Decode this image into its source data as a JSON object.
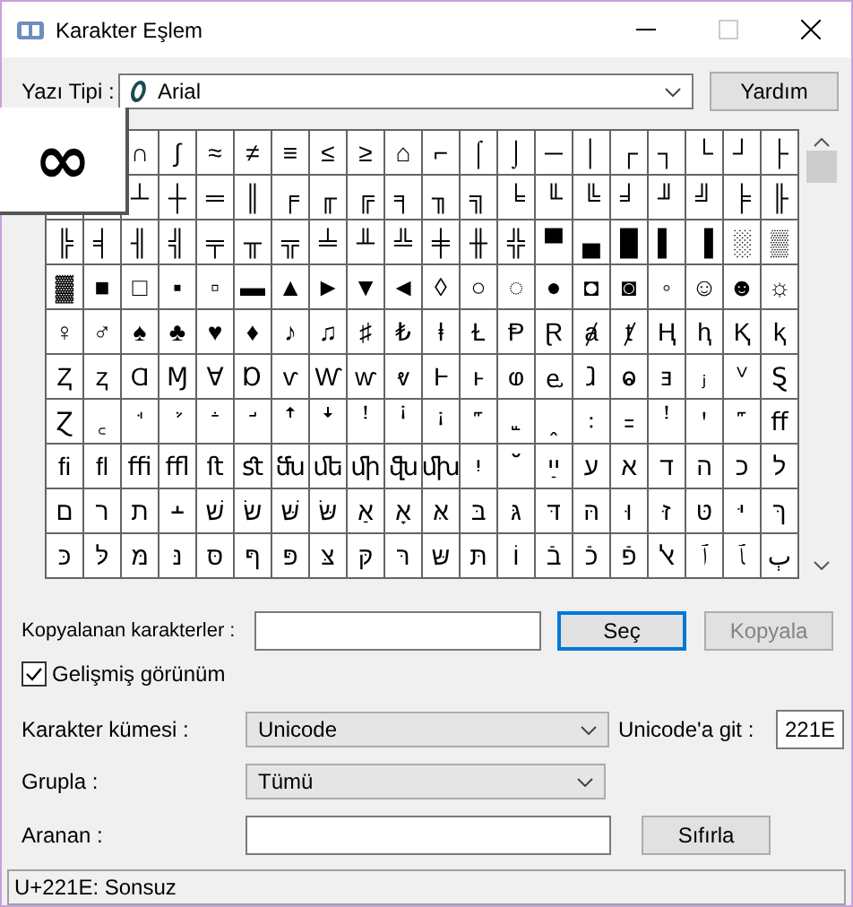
{
  "window": {
    "title": "Karakter Eşlem"
  },
  "font": {
    "label": "Yazı Tipi :",
    "value": "Arial"
  },
  "help_button": "Yardım",
  "magnified": "∞",
  "grid": {
    "rows": [
      [
        "",
        "",
        "∩",
        "∫",
        "≈",
        "≠",
        "≡",
        "≤",
        "≥",
        "⌂",
        "⌐",
        "⌠",
        "⌡",
        "─",
        "│",
        "┌",
        "┐",
        "└",
        "┘",
        "├"
      ],
      [
        "",
        "",
        "┴",
        "┼",
        "═",
        "║",
        "╒",
        "╓",
        "╔",
        "╕",
        "╖",
        "╗",
        "╘",
        "╙",
        "╚",
        "╛",
        "╜",
        "╝",
        "╞",
        "╟"
      ],
      [
        "╠",
        "╡",
        "╢",
        "╣",
        "╤",
        "╥",
        "╦",
        "╧",
        "╨",
        "╩",
        "╪",
        "╫",
        "╬",
        "▀",
        "▄",
        "█",
        "▌",
        "▐",
        "░",
        "▒"
      ],
      [
        "▓",
        "■",
        "□",
        "▪",
        "▫",
        "▬",
        "▲",
        "►",
        "▼",
        "◄",
        "◊",
        "○",
        "◌",
        "●",
        "◘",
        "◙",
        "◦",
        "☺",
        "☻",
        "☼"
      ],
      [
        "♀",
        "♂",
        "♠",
        "♣",
        "♥",
        "♦",
        "♪",
        "♫",
        "♯",
        "₺",
        "ⱡ",
        "Ɫ",
        "Ᵽ",
        "Ɽ",
        "ⱥ",
        "ⱦ",
        "Ⱨ",
        "ⱨ",
        "Ⱪ",
        "ⱪ"
      ],
      [
        "Ⱬ",
        "ⱬ",
        "Ɑ",
        "Ɱ",
        "Ɐ",
        "Ɒ",
        "ⱱ",
        "Ⱳ",
        "ⱳ",
        "ⱴ",
        "Ⱶ",
        "ⱶ",
        "ⱷ",
        "ⱸ",
        "ⱹ",
        "ⱺ",
        "ⱻ",
        "ⱼ",
        "ⱽ",
        "Ȿ"
      ],
      [
        "Ɀ",
        "꜀",
        "ꜗ",
        "ꜘ",
        "ꜙ",
        "ꜚ",
        "ꜛ",
        "ꜜ",
        "ꜝ",
        "ꜞ",
        "ꜟ",
        "꜠",
        "꜡",
        "ꞈ",
        "꞉",
        "꞊",
        "ꜝ",
        "ꞌ",
        "꜠",
        "ﬀ"
      ],
      [
        "ﬁ",
        "ﬂ",
        "ﬃ",
        "ﬄ",
        "ﬅ",
        "ﬆ",
        "ﬓ",
        "ﬔ",
        "ﬕ",
        "ﬖ",
        "ﬗ",
        "יִ",
        "ﬞ",
        "ײַ",
        "ﬠ",
        "ﬡ",
        "ﬢ",
        "ﬣ",
        "ﬤ",
        "ﬥ"
      ],
      [
        "ﬦ",
        "ﬧ",
        "ﬨ",
        "﬩",
        "שׁ",
        "שׂ",
        "שּׁ",
        "שּׂ",
        "אַ",
        "אָ",
        "אּ",
        "בּ",
        "גּ",
        "דּ",
        "הּ",
        "וּ",
        "זּ",
        "טּ",
        "יּ",
        "ךּ"
      ],
      [
        "כּ",
        "לּ",
        "מּ",
        "נּ",
        "סּ",
        "ףּ",
        "פּ",
        "צּ",
        "קּ",
        "רּ",
        "שּ",
        "תּ",
        "וֹ",
        "בֿ",
        "כֿ",
        "פֿ",
        "ﭏ",
        "ﭐ",
        "ﭑ",
        "ﭒ"
      ]
    ]
  },
  "copy": {
    "label": "Kopyalanan karakterler :",
    "select_button": "Seç",
    "copy_button": {
      "label": "Kopyala",
      "disabled": true
    }
  },
  "advanced_view": {
    "label": "Gelişmiş görünüm",
    "checked": true
  },
  "charset": {
    "label": "Karakter kümesi :",
    "value": "Unicode"
  },
  "goto_unicode": {
    "label": "Unicode'a git :",
    "value": "221E"
  },
  "group_by": {
    "label": "Grupla :",
    "value": "Tümü"
  },
  "search": {
    "label": "Aranan :",
    "button": "Sıfırla"
  },
  "status_bar": "U+221E: Sonsuz"
}
